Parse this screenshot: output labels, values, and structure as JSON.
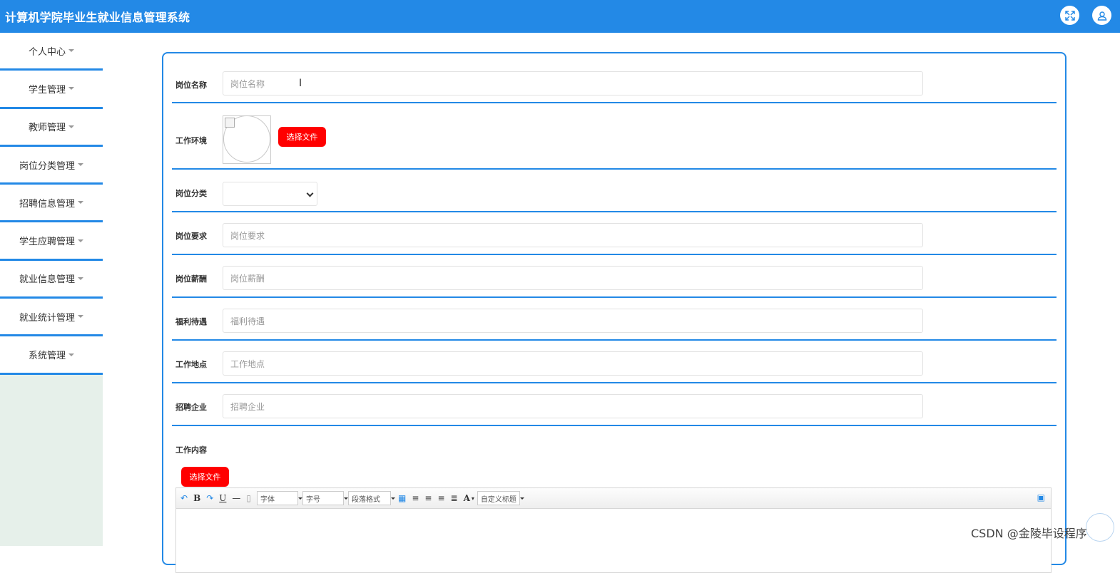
{
  "app": {
    "title": "计算机学院毕业生就业信息管理系统"
  },
  "header": {
    "fullscreen_icon": "expand-icon",
    "user_icon": "user-icon"
  },
  "sidebar": {
    "items": [
      {
        "label": "个人中心"
      },
      {
        "label": "学生管理"
      },
      {
        "label": "教师管理"
      },
      {
        "label": "岗位分类管理"
      },
      {
        "label": "招聘信息管理"
      },
      {
        "label": "学生应聘管理"
      },
      {
        "label": "就业信息管理"
      },
      {
        "label": "就业统计管理"
      },
      {
        "label": "系统管理"
      }
    ]
  },
  "form": {
    "job_name": {
      "label": "岗位名称",
      "placeholder": "岗位名称"
    },
    "environment": {
      "label": "工作环境",
      "button": "选择文件"
    },
    "category": {
      "label": "岗位分类",
      "value": ""
    },
    "requirement": {
      "label": "岗位要求",
      "placeholder": "岗位要求"
    },
    "salary": {
      "label": "岗位薪酬",
      "placeholder": "岗位薪酬"
    },
    "welfare": {
      "label": "福利待遇",
      "placeholder": "福利待遇"
    },
    "location": {
      "label": "工作地点",
      "placeholder": "工作地点"
    },
    "company": {
      "label": "招聘企业",
      "placeholder": "招聘企业"
    },
    "content": {
      "label": "工作内容",
      "button": "选择文件"
    }
  },
  "editor_toolbar": {
    "bold": "B",
    "underline": "U",
    "hr": "—",
    "font": "字体",
    "size": "字号",
    "paragraph": "段落格式",
    "fontcolor": "A",
    "custom_title": "自定义标题"
  },
  "watermark": "CSDN @金陵毕设程序",
  "colors": {
    "primary": "#2389e6",
    "danger": "#ff0000",
    "sidebar_bg": "#e6f0ea"
  }
}
